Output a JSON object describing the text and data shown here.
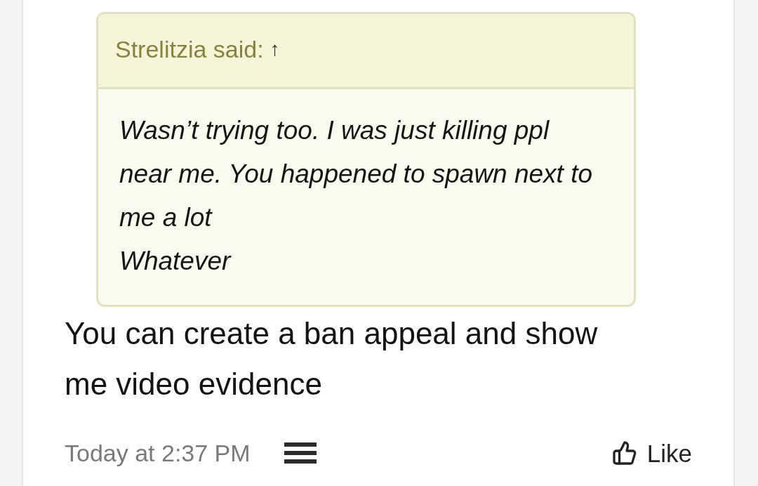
{
  "post": {
    "quote": {
      "author_line": "Strelitzia said:",
      "jump_arrow": "↑",
      "paragraphs": [
        "Wasn’t trying too. I was just killing ppl near me. You happened to spawn next to me a lot",
        "Whatever"
      ]
    },
    "message": "You can create a ban appeal and show me video evidence",
    "footer": {
      "timestamp": "Today at 2:37 PM",
      "like": {
        "label": "Like"
      }
    }
  }
}
